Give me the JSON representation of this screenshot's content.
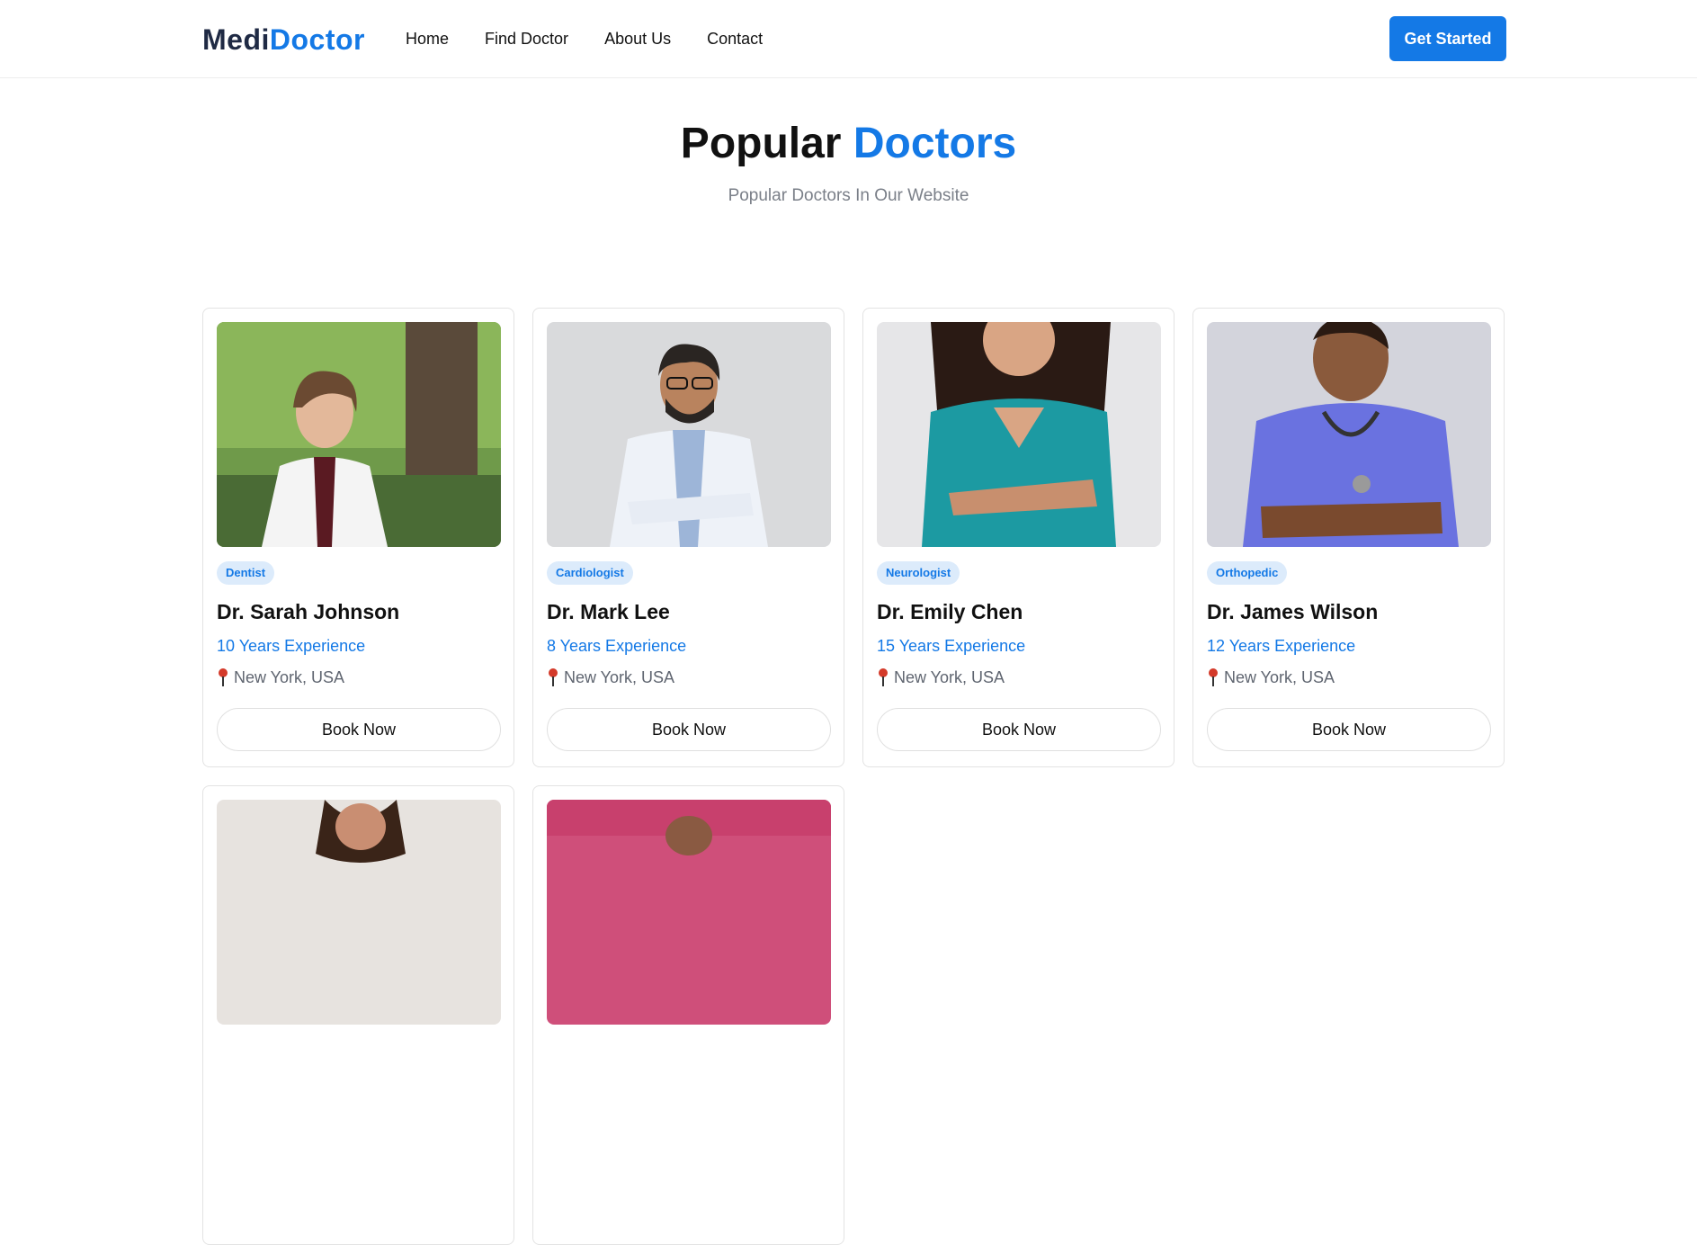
{
  "header": {
    "logo_part1": "Medi",
    "logo_part2": "Doctor",
    "nav": [
      "Home",
      "Find Doctor",
      "About Us",
      "Contact"
    ],
    "cta_label": "Get Started"
  },
  "section": {
    "title_part1": "Popular",
    "title_part2": "Doctors",
    "subtitle": "Popular Doctors In Our Website"
  },
  "doctors": [
    {
      "specialty": "Dentist",
      "name": "Dr. Sarah Johnson",
      "experience": "10 Years Experience",
      "location": "New York, USA",
      "button": "Book Now"
    },
    {
      "specialty": "Cardiologist",
      "name": "Dr. Mark Lee",
      "experience": "8 Years Experience",
      "location": "New York, USA",
      "button": "Book Now"
    },
    {
      "specialty": "Neurologist",
      "name": "Dr. Emily Chen",
      "experience": "15 Years Experience",
      "location": "New York, USA",
      "button": "Book Now"
    },
    {
      "specialty": "Orthopedic",
      "name": "Dr. James Wilson",
      "experience": "12 Years Experience",
      "location": "New York, USA",
      "button": "Book Now"
    }
  ],
  "icons": {
    "location": "location-pin-icon"
  },
  "colors": {
    "accent": "#1479e6",
    "badge_bg": "#dcebfb",
    "logo_dark": "#1f2a44"
  }
}
